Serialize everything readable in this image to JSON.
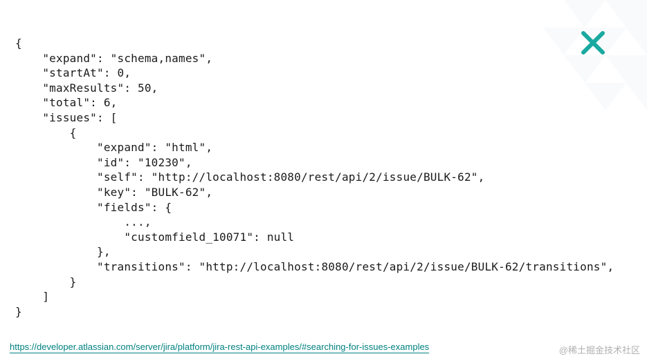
{
  "logo": {
    "letter": "X",
    "color": "#1aa9a0"
  },
  "code_lines": [
    "{",
    "    \"expand\": \"schema,names\",",
    "    \"startAt\": 0,",
    "    \"maxResults\": 50,",
    "    \"total\": 6,",
    "    \"issues\": [",
    "        {",
    "            \"expand\": \"html\",",
    "            \"id\": \"10230\",",
    "            \"self\": \"http://localhost:8080/rest/api/2/issue/BULK-62\",",
    "            \"key\": \"BULK-62\",",
    "            \"fields\": {",
    "                ...,",
    "                \"customfield_10071\": null",
    "            },",
    "            \"transitions\": \"http://localhost:8080/rest/api/2/issue/BULK-62/transitions\",",
    "        }",
    "    ]",
    "}"
  ],
  "footer": {
    "link_text": "https://developer.atlassian.com/server/jira/platform/jira-rest-api-examples/#searching-for-issues-examples"
  },
  "watermark": "@稀土掘金技术社区"
}
